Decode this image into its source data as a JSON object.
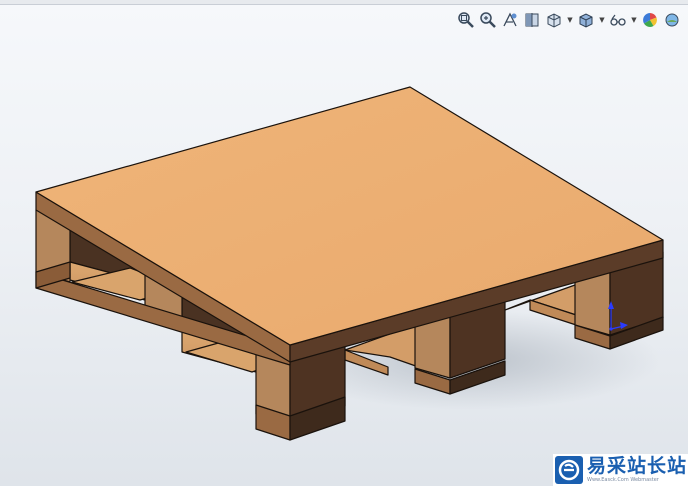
{
  "toolbar": {
    "icons": [
      "zoom-to-fit-icon",
      "zoom-to-area-icon",
      "previous-view-icon",
      "section-view-icon",
      "view-orientation-icon",
      "display-style-icon",
      "hide-show-items-icon",
      "edit-appearance-icon",
      "apply-scene-icon"
    ]
  },
  "model": {
    "name": "wooden-pallet",
    "colors": {
      "deck_top": "#ECAF73",
      "edge_front": "#9A6A43",
      "edge_right": "#5B3C28",
      "block_front": "#B5875C",
      "block_side": "#4E3322",
      "interior_dark": "#4A3222",
      "floor": "#D8A46E",
      "outline": "#1a120c"
    }
  },
  "triad": {
    "x_color": "#2a3cff",
    "y_color": "#2a3cff"
  },
  "watermark": {
    "title": "易采站长站",
    "subtitle": "Www.Easck.Com Webmaster",
    "logo_letter": "e"
  }
}
